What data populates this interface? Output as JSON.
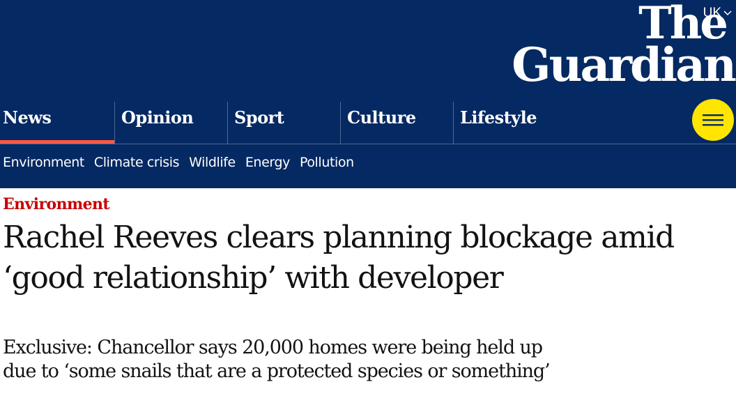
{
  "header": {
    "edition": "UK",
    "logo": {
      "line1": "The",
      "line2": "Guardian"
    },
    "pillars": [
      {
        "label": "News",
        "active": true
      },
      {
        "label": "Opinion",
        "active": false
      },
      {
        "label": "Sport",
        "active": false
      },
      {
        "label": "Culture",
        "active": false
      },
      {
        "label": "Lifestyle",
        "active": false
      }
    ],
    "subnav": [
      "Environment",
      "Climate crisis",
      "Wildlife",
      "Energy",
      "Pollution"
    ],
    "colors": {
      "brand_background": "#052962",
      "active_pillar_underline": "#ff5943",
      "menu_button": "#ffe500"
    }
  },
  "article": {
    "section": "Environment",
    "headline": "Rachel Reeves clears planning blockage amid ‘good relationship’ with developer",
    "standfirst": "Exclusive: Chancellor says 20,000 homes were being held up due to ‘some snails that are a protected species or something’",
    "colors": {
      "section_label": "#c70000"
    }
  }
}
